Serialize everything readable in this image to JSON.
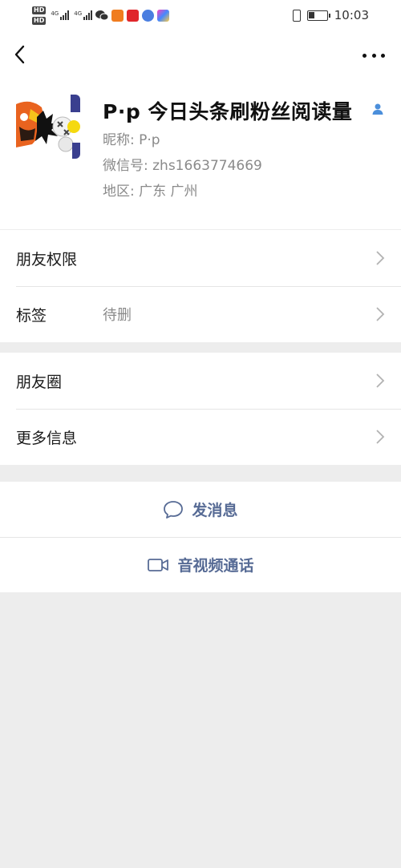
{
  "status_bar": {
    "hd_label": "HD",
    "network_label": "4G",
    "time": "10:03"
  },
  "profile": {
    "display_name": "P·p 今日头条刷粉丝阅读量",
    "nickname": "昵称:  P·p",
    "wechat_id": "微信号:  zhs1663774669",
    "region": "地区:  广东  广州",
    "gender": "male"
  },
  "cells": {
    "friend_permissions": "朋友权限",
    "tags_label": "标签",
    "tags_value": "待删",
    "moments": "朋友圈",
    "more_info": "更多信息"
  },
  "actions": {
    "send_message": "发消息",
    "video_call": "音视频通话"
  },
  "colors": {
    "link": "#576b95",
    "gender_male": "#4b8fdb",
    "background": "#ededed"
  }
}
